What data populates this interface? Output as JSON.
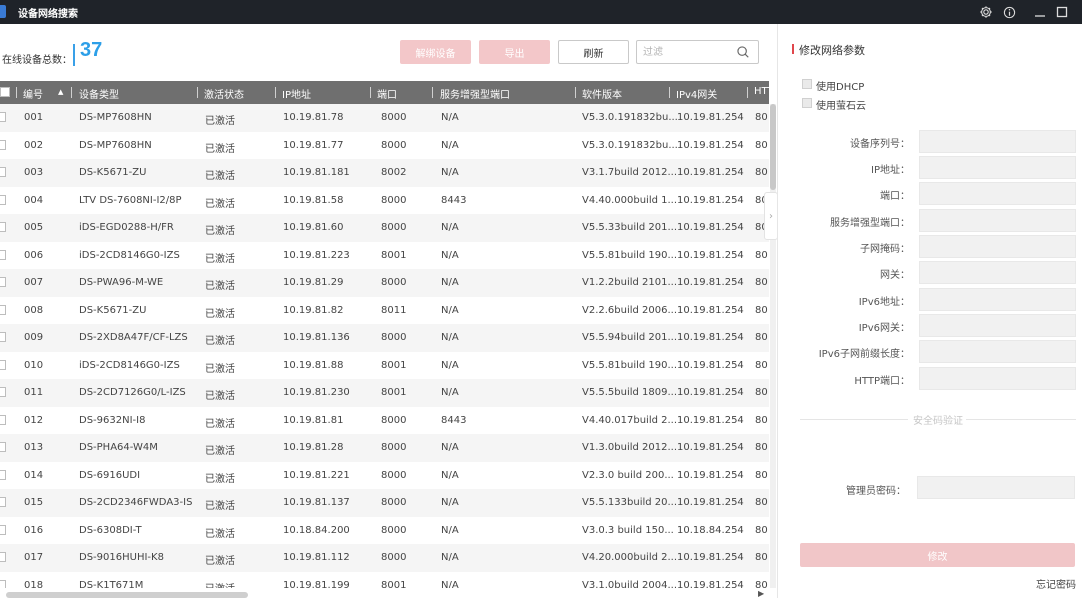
{
  "window": {
    "title": "设备网络搜索",
    "controls": [
      "gear-icon",
      "info-icon",
      "minimize-icon",
      "maximize-icon"
    ]
  },
  "summary": {
    "online_label": "在线设备总数：",
    "online_count": "37"
  },
  "toolbar": {
    "activate_label": "解绑设备",
    "export_label": "导出",
    "refresh_label": "刷新",
    "filter_placeholder": "过滤"
  },
  "colors": {
    "accent_blue": "#2d9fe8",
    "accent_red": "#e0474c",
    "disabled_pink": "#f3c7c9",
    "titlebar": "#1f2329",
    "table_header": "#6f6f6f"
  },
  "table": {
    "columns": [
      {
        "label": "编号",
        "sort": "asc"
      },
      {
        "label": "设备类型"
      },
      {
        "label": "激活状态"
      },
      {
        "label": "IP地址"
      },
      {
        "label": "端口"
      },
      {
        "label": "服务增强型端口"
      },
      {
        "label": "软件版本"
      },
      {
        "label": "IPv4网关"
      },
      {
        "label": "HTT"
      }
    ],
    "rows": [
      {
        "no": "001",
        "type": "DS-MP7608HN",
        "status": "已激活",
        "ip": "10.19.81.78",
        "port": "8000",
        "enh": "N/A",
        "ver": "V5.3.0.191832bu...",
        "gw": "10.19.81.254",
        "http": "80"
      },
      {
        "no": "002",
        "type": "DS-MP7608HN",
        "status": "已激活",
        "ip": "10.19.81.77",
        "port": "8000",
        "enh": "N/A",
        "ver": "V5.3.0.191832bu...",
        "gw": "10.19.81.254",
        "http": "80"
      },
      {
        "no": "003",
        "type": "DS-K5671-ZU",
        "status": "已激活",
        "ip": "10.19.81.181",
        "port": "8002",
        "enh": "N/A",
        "ver": "V3.1.7build 2012...",
        "gw": "10.19.81.254",
        "http": "80"
      },
      {
        "no": "004",
        "type": "LTV DS-7608NI-I2/8P",
        "status": "已激活",
        "ip": "10.19.81.58",
        "port": "8000",
        "enh": "8443",
        "ver": "V4.40.000build 1...",
        "gw": "10.19.81.254",
        "http": "80"
      },
      {
        "no": "005",
        "type": "iDS-EGD0288-H/FR",
        "status": "已激活",
        "ip": "10.19.81.60",
        "port": "8000",
        "enh": "N/A",
        "ver": "V5.5.33build 201...",
        "gw": "10.19.81.254",
        "http": "80"
      },
      {
        "no": "006",
        "type": "iDS-2CD8146G0-IZS",
        "status": "已激活",
        "ip": "10.19.81.223",
        "port": "8001",
        "enh": "N/A",
        "ver": "V5.5.81build 190...",
        "gw": "10.19.81.254",
        "http": "80"
      },
      {
        "no": "007",
        "type": "DS-PWA96-M-WE",
        "status": "已激活",
        "ip": "10.19.81.29",
        "port": "8000",
        "enh": "N/A",
        "ver": "V1.2.2build 2101...",
        "gw": "10.19.81.254",
        "http": "80"
      },
      {
        "no": "008",
        "type": "DS-K5671-ZU",
        "status": "已激活",
        "ip": "10.19.81.82",
        "port": "8011",
        "enh": "N/A",
        "ver": "V2.2.6build 2006...",
        "gw": "10.19.81.254",
        "http": "80"
      },
      {
        "no": "009",
        "type": "DS-2XD8A47F/CF-LZS",
        "status": "已激活",
        "ip": "10.19.81.136",
        "port": "8000",
        "enh": "N/A",
        "ver": "V5.5.94build 201...",
        "gw": "10.19.81.254",
        "http": "80"
      },
      {
        "no": "010",
        "type": "iDS-2CD8146G0-IZS",
        "status": "已激活",
        "ip": "10.19.81.88",
        "port": "8001",
        "enh": "N/A",
        "ver": "V5.5.81build 190...",
        "gw": "10.19.81.254",
        "http": "80"
      },
      {
        "no": "011",
        "type": "DS-2CD7126G0/L-IZS",
        "status": "已激活",
        "ip": "10.19.81.230",
        "port": "8001",
        "enh": "N/A",
        "ver": "V5.5.5build 1809...",
        "gw": "10.19.81.254",
        "http": "80"
      },
      {
        "no": "012",
        "type": "DS-9632NI-I8",
        "status": "已激活",
        "ip": "10.19.81.81",
        "port": "8000",
        "enh": "8443",
        "ver": "V4.40.017build 2...",
        "gw": "10.19.81.254",
        "http": "80"
      },
      {
        "no": "013",
        "type": "DS-PHA64-W4M",
        "status": "已激活",
        "ip": "10.19.81.28",
        "port": "8000",
        "enh": "N/A",
        "ver": "V1.3.0build 2012...",
        "gw": "10.19.81.254",
        "http": "80"
      },
      {
        "no": "014",
        "type": "DS-6916UDI",
        "status": "已激活",
        "ip": "10.19.81.221",
        "port": "8000",
        "enh": "N/A",
        "ver": "V2.3.0 build 200...",
        "gw": "10.19.81.254",
        "http": "80"
      },
      {
        "no": "015",
        "type": "DS-2CD2346FWDA3-IS",
        "status": "已激活",
        "ip": "10.19.81.137",
        "port": "8000",
        "enh": "N/A",
        "ver": "V5.5.133build 20...",
        "gw": "10.19.81.254",
        "http": "80"
      },
      {
        "no": "016",
        "type": "DS-6308DI-T",
        "status": "已激活",
        "ip": "10.18.84.200",
        "port": "8000",
        "enh": "N/A",
        "ver": "V3.0.3 build 150...",
        "gw": "10.18.84.254",
        "http": "80"
      },
      {
        "no": "017",
        "type": "DS-9016HUHI-K8",
        "status": "已激活",
        "ip": "10.19.81.112",
        "port": "8000",
        "enh": "N/A",
        "ver": "V4.20.000build 2...",
        "gw": "10.19.81.254",
        "http": "80"
      },
      {
        "no": "018",
        "type": "DS-K1T671M",
        "status": "已激活",
        "ip": "10.19.81.199",
        "port": "8001",
        "enh": "N/A",
        "ver": "V3.1.0build 2004...",
        "gw": "10.19.81.254",
        "http": "80"
      }
    ]
  },
  "panel": {
    "title": "修改网络参数",
    "use_dhcp": "使用DHCP",
    "use_ezviz": "使用萤石云",
    "fields": [
      {
        "key": "serial",
        "label": "设备序列号："
      },
      {
        "key": "ip",
        "label": "IP地址："
      },
      {
        "key": "port",
        "label": "端口："
      },
      {
        "key": "enh_port",
        "label": "服务增强型端口："
      },
      {
        "key": "mask",
        "label": "子网掩码："
      },
      {
        "key": "gateway",
        "label": "网关："
      },
      {
        "key": "ipv6",
        "label": "IPv6地址："
      },
      {
        "key": "ipv6gw",
        "label": "IPv6网关："
      },
      {
        "key": "ipv6prefix",
        "label": "IPv6子网前缀长度："
      },
      {
        "key": "http",
        "label": "HTTP端口："
      }
    ],
    "security_divider": "安全码验证",
    "admin_password_label": "管理员密码：",
    "modify_label": "修改",
    "forgot_label": "忘记密码"
  }
}
